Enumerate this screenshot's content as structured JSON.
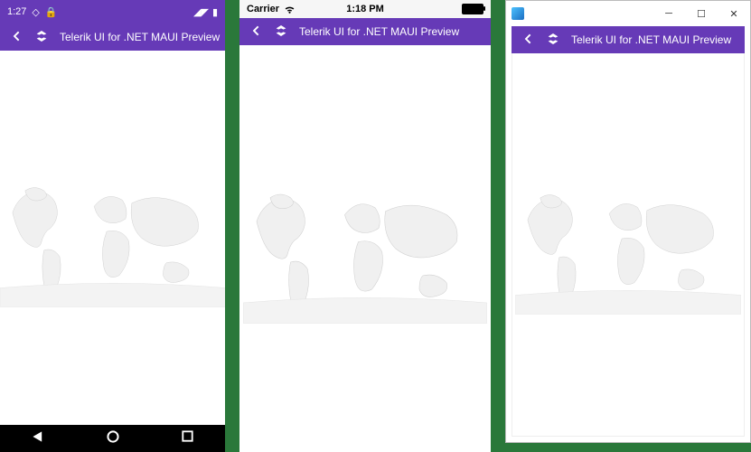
{
  "common": {
    "app_title": "Telerik UI for .NET MAUI Preview",
    "brand_color": "#663ab7",
    "back_icon": "chevron-left-icon",
    "logo_icon": "telerik-logo-icon"
  },
  "android": {
    "status": {
      "clock": "1:27",
      "icons": [
        "gps-icon",
        "lock-icon"
      ],
      "right_icons": [
        "signal-icon",
        "battery-icon"
      ]
    },
    "nav": {
      "back": "triangle",
      "home": "circle",
      "recents": "square"
    }
  },
  "ios": {
    "status": {
      "carrier": "Carrier",
      "wifi_icon": "wifi-icon",
      "clock": "1:18 PM",
      "battery_icon": "battery-full-icon"
    }
  },
  "windows": {
    "app_icon": "app-icon",
    "controls": {
      "min": "─",
      "max": "☐",
      "close": "✕"
    }
  }
}
